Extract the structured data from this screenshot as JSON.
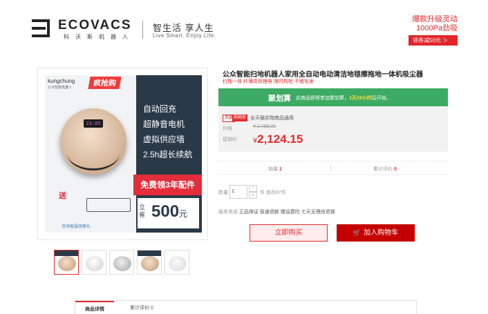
{
  "header": {
    "logo_text": "ECOVACS",
    "logo_sub": "科沃斯机器人",
    "slogan": "智生活  享人生",
    "slogan_en": "Live Smart. Enjoy Life.",
    "promo_line1": "爆款升级灵动",
    "promo_line2": "1000Pa劲吸",
    "promo_button": "领券减50元 ＞"
  },
  "main_image": {
    "brand": "kungchung",
    "brand_sub": "公众智能机器人",
    "rush_tag": "疯抢购",
    "display": "23:05",
    "features": [
      "自动回充",
      "超静音电机",
      "虚拟供应墙",
      "2.5h超长续航"
    ],
    "free_text": "免费领3年配件",
    "price_tag": "立省",
    "price_value": "500",
    "price_unit": "元",
    "gift_label": "送",
    "footer_note": "咨询客服领豪礼"
  },
  "thumbs": [
    {
      "name": "thumb-1"
    },
    {
      "name": "thumb-2"
    },
    {
      "name": "thumb-3"
    },
    {
      "name": "thumb-4"
    },
    {
      "name": "thumb-5"
    }
  ],
  "product": {
    "title": "公众智能扫地机器人家用全自动电动清洁地毯擦拖地一体机吸尘器",
    "subtitle": "扫拖一体 纤薄高效锂电 限时购抢 不缠毛发",
    "jhs_title": "聚划算",
    "jhs_note_pre": "此商品即将参加聚划算，",
    "jhs_note_hl": "1天19小时",
    "jhs_note_post": "后开始，",
    "tmall_tag": "天猫",
    "shop_tag": "购物券",
    "tmall_note": "全天猫实物商品通用",
    "price_label": "价格",
    "old_price": "¥ 2,499.00",
    "promo_label": "促销价",
    "currency": "¥",
    "promo_price": "2,124.15"
  },
  "stats": {
    "sales_label": "销量",
    "sales_value": "1",
    "reviews_label": "累计评价",
    "reviews_value": "0"
  },
  "quantity": {
    "label": "数量",
    "value": "1",
    "unit_text": "件 库存87件",
    "up": "^",
    "down": "v"
  },
  "service": {
    "label": "服务承诺",
    "items": "正品保证 极速退款 赠运费险 七天无理由退换"
  },
  "actions": {
    "buy_label": "立即购买",
    "cart_label": "加入购物车"
  },
  "tabs": [
    {
      "label": "商品详情"
    },
    {
      "label": "累计评价 0"
    }
  ]
}
